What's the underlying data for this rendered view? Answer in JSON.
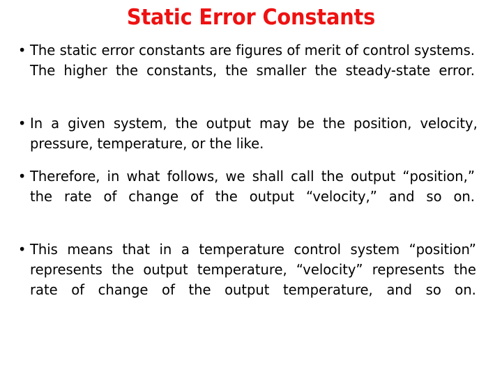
{
  "slide": {
    "title": "Static Error Constants",
    "title_color": "#ee1111",
    "background_color": "#ffffff",
    "text_color": "#000000",
    "bullet_marker": "•",
    "bullets": [
      {
        "id": "static-error-constants-definition",
        "text": "The static error constants are figures of merit of control systems. The higher the constants, the smaller the steady-state error."
      },
      {
        "id": "output-quantities",
        "text": "In a given system, the output may be the position, velocity, pressure, temperature, or the like."
      },
      {
        "id": "terminology-convention",
        "text": "Therefore, in what follows, we shall call the output “position,” the rate of change of the output “velocity,” and so on."
      },
      {
        "id": "temperature-control-example",
        "text": "This means that in a temperature control system “position” represents the output temperature, “velocity” represents the rate of change of the output temperature, and so on."
      }
    ]
  }
}
